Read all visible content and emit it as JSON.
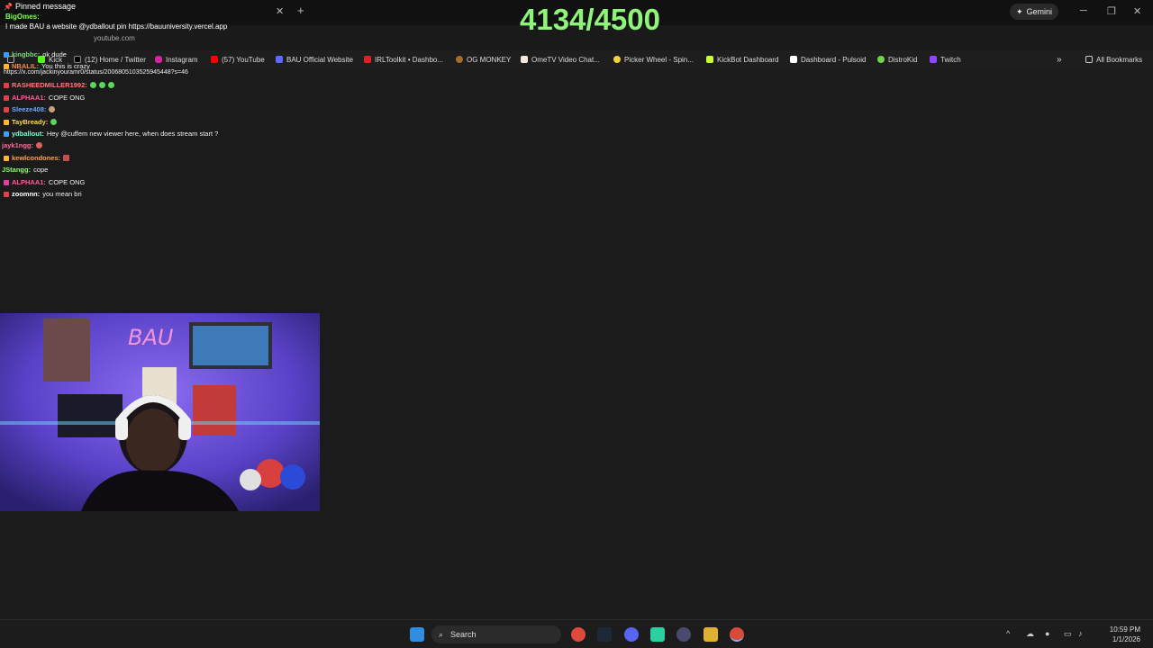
{
  "browser": {
    "pinned_header": "Pinned message",
    "pinned_user": "BigOmes:",
    "pinned_text": "I made BAU a website @ydballout pin https://bauuniversity.vercel.app",
    "address_fragment": "youtube.com",
    "gemini_label": "Gemini",
    "all_bookmarks_label": "All Bookmarks",
    "bookmarks": [
      {
        "label": "Kick"
      },
      {
        "label": "(12) Home / Twitter"
      },
      {
        "label": "Instagram"
      },
      {
        "label": "(57) YouTube"
      },
      {
        "label": "BAU Official Website"
      },
      {
        "label": "IRLToolkit • Dashbo..."
      },
      {
        "label": "OG MONKEY"
      },
      {
        "label": "OmeTV Video Chat..."
      },
      {
        "label": "Picker Wheel - Spin..."
      },
      {
        "label": "KickBot Dashboard"
      },
      {
        "label": "Dashboard - Pulsoid"
      },
      {
        "label": "DistroKid"
      },
      {
        "label": "Twitch"
      }
    ]
  },
  "counter": {
    "text": "4134/4500"
  },
  "chat": {
    "lines": [
      {
        "name": "kingbbc:",
        "text": "ok dude",
        "color": "#7fd67a"
      },
      {
        "name": "NBALIL:",
        "text": "You this is crazy",
        "color": "#ff8a3d"
      },
      {
        "name": "",
        "text": "https://x.com/jackinyouramr0/status/2006805103525945448?s=46",
        "color": "#ffffff"
      },
      {
        "name": "RASHEEDMILLER1992:",
        "text": "",
        "color": "#ff7a7a"
      },
      {
        "name": "ALPHAA1:",
        "text": "COPE ONG",
        "color": "#ff5e9a"
      },
      {
        "name": "Sleeze408:",
        "text": "",
        "color": "#6fa8ff"
      },
      {
        "name": "TayBready:",
        "text": "",
        "color": "#ffd84a"
      },
      {
        "name": "ydballout:",
        "text": "Hey @cuffem new viewer here, when does stream start ?",
        "color": "#7cffd6"
      },
      {
        "name": "jayk1ngg:",
        "text": "",
        "color": "#ff6b9a"
      },
      {
        "name": "kewlcondones:",
        "text": "",
        "color": "#ffa24a"
      },
      {
        "name": "JStangg:",
        "text": "cope",
        "color": "#8cff6a"
      },
      {
        "name": "ALPHAA1:",
        "text": "COPE ONG",
        "color": "#ff5e9a"
      },
      {
        "name": "zoomnn:",
        "text": "you mean bri",
        "color": "#ffffff"
      }
    ]
  },
  "taskbar": {
    "search_label": "Search",
    "time": "10:59 PM",
    "date": "1/1/2026"
  }
}
